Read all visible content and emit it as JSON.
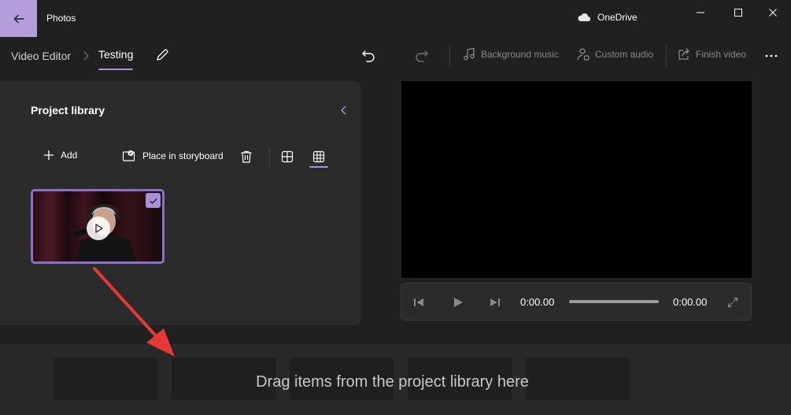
{
  "window": {
    "app_title": "Photos",
    "cloud_label": "OneDrive",
    "back_icon": "back-arrow-icon",
    "controls": [
      "minimize-icon",
      "maximize-icon",
      "close-icon"
    ]
  },
  "toolbar": {
    "breadcrumb_root": "Video Editor",
    "breadcrumb_current": "Testing",
    "undo_icon": "undo-icon",
    "redo_icon": "redo-icon",
    "background_music": "Background music",
    "custom_audio": "Custom audio",
    "finish_video": "Finish video",
    "more_icon": "more-icon"
  },
  "library": {
    "title": "Project library",
    "add_label": "Add",
    "place_label": "Place in storyboard",
    "items": [
      {
        "type": "video",
        "selected": true
      }
    ]
  },
  "player": {
    "current_time": "0:00.00",
    "total_time": "0:00.00",
    "progress": 0
  },
  "storyboard": {
    "empty_message": "Drag items from the project library here",
    "slot_count": 5
  },
  "colors": {
    "accent": "#a98fd8",
    "back_button": "#b39ddb",
    "background": "#202020",
    "panel": "#2b2b2b",
    "annotation_arrow": "#e53935"
  }
}
